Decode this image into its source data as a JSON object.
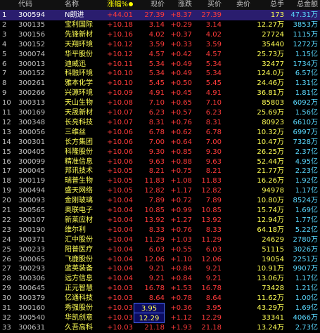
{
  "headers": {
    "idx": "",
    "code": "代码",
    "name": "名称",
    "pct": "涨幅%",
    "price": "现价",
    "chg": "涨跌",
    "bid": "买价",
    "ask": "卖价",
    "vol": "总手",
    "amt": "总金额"
  },
  "rows": [
    {
      "idx": "1",
      "code": "300594",
      "name": "N朗进",
      "pct": "+44.01",
      "price": "27.39",
      "chg": "+8.37",
      "bid": "27.39",
      "ask": "",
      "vol": "173",
      "amt": "47.31万"
    },
    {
      "idx": "2",
      "code": "300135",
      "name": "宝利国际",
      "pct": "+10.18",
      "price": "3.14",
      "chg": "+0.29",
      "bid": "3.14",
      "ask": "",
      "vol": "12.27万",
      "amt": "3853万"
    },
    {
      "idx": "3",
      "code": "300156",
      "name": "先锋新材",
      "pct": "+10.16",
      "price": "4.02",
      "chg": "+0.37",
      "bid": "4.02",
      "ask": "",
      "vol": "27724",
      "amt": "1115万"
    },
    {
      "idx": "4",
      "code": "300152",
      "name": "天翔环境",
      "pct": "+10.12",
      "price": "3.59",
      "chg": "+0.33",
      "bid": "3.59",
      "ask": "",
      "vol": "35440",
      "amt": "1272万"
    },
    {
      "idx": "5",
      "code": "300074",
      "name": "华平股份",
      "pct": "+10.12",
      "price": "4.57",
      "chg": "+0.42",
      "bid": "4.57",
      "ask": "",
      "vol": "25.73万",
      "amt": "1.15亿"
    },
    {
      "idx": "6",
      "code": "300013",
      "name": "迪威迅",
      "pct": "+10.11",
      "price": "5.34",
      "chg": "+0.49",
      "bid": "5.34",
      "ask": "",
      "vol": "32477",
      "amt": "1734万"
    },
    {
      "idx": "7",
      "code": "300152",
      "name": "科融环境",
      "pct": "+10.10",
      "price": "5.34",
      "chg": "+0.49",
      "bid": "5.34",
      "ask": "",
      "vol": "124.0万",
      "amt": "6.57亿"
    },
    {
      "idx": "8",
      "code": "300261",
      "name": "雅本化学",
      "pct": "+10.10",
      "price": "5.45",
      "chg": "+0.50",
      "bid": "5.45",
      "ask": "",
      "vol": "24.46万",
      "amt": "1.31亿"
    },
    {
      "idx": "9",
      "code": "300266",
      "name": "兴源环境",
      "pct": "+10.09",
      "price": "4.91",
      "chg": "+0.45",
      "bid": "4.91",
      "ask": "",
      "vol": "36.81万",
      "amt": "1.81亿"
    },
    {
      "idx": "10",
      "code": "300313",
      "name": "天山生物",
      "pct": "+10.08",
      "price": "7.10",
      "chg": "+0.65",
      "bid": "7.10",
      "ask": "",
      "vol": "85803",
      "amt": "6092万"
    },
    {
      "idx": "11",
      "code": "300169",
      "name": "天晟新材",
      "pct": "+10.07",
      "price": "6.23",
      "chg": "+0.57",
      "bid": "6.23",
      "ask": "",
      "vol": "25.69万",
      "amt": "1.56亿"
    },
    {
      "idx": "12",
      "code": "300348",
      "name": "长亮科技",
      "pct": "+10.07",
      "price": "8.31",
      "chg": "+0.76",
      "bid": "8.31",
      "ask": "",
      "vol": "80923",
      "amt": "6610万"
    },
    {
      "idx": "13",
      "code": "300056",
      "name": "三维丝",
      "pct": "+10.06",
      "price": "6.78",
      "chg": "+0.62",
      "bid": "6.78",
      "ask": "",
      "vol": "10.32万",
      "amt": "6997万"
    },
    {
      "idx": "14",
      "code": "300301",
      "name": "长方集团",
      "pct": "+10.06",
      "price": "7.00",
      "chg": "+0.64",
      "bid": "7.00",
      "ask": "",
      "vol": "10.47万",
      "amt": "7328万"
    },
    {
      "idx": "15",
      "code": "300405",
      "name": "科隆股份",
      "pct": "+10.06",
      "price": "9.30",
      "chg": "+0.85",
      "bid": "9.30",
      "ask": "",
      "vol": "26.25万",
      "amt": "2.37亿"
    },
    {
      "idx": "16",
      "code": "300099",
      "name": "精准信息",
      "pct": "+10.06",
      "price": "9.63",
      "chg": "+0.88",
      "bid": "9.63",
      "ask": "",
      "vol": "52.44万",
      "amt": "4.95亿"
    },
    {
      "idx": "17",
      "code": "300045",
      "name": "邦讯技术",
      "pct": "+10.05",
      "price": "8.21",
      "chg": "+0.75",
      "bid": "8.21",
      "ask": "",
      "vol": "21.77万",
      "amt": "2.23亿"
    },
    {
      "idx": "18",
      "code": "300119",
      "name": "瑞普生物",
      "pct": "+10.05",
      "price": "11.83",
      "chg": "+1.08",
      "bid": "11.83",
      "ask": "",
      "vol": "16.26万",
      "amt": "1.92亿"
    },
    {
      "idx": "19",
      "code": "300494",
      "name": "盛天网络",
      "pct": "+10.05",
      "price": "12.82",
      "chg": "+1.17",
      "bid": "12.82",
      "ask": "",
      "vol": "94978",
      "amt": "1.17亿"
    },
    {
      "idx": "20",
      "code": "300093",
      "name": "金刚玻璃",
      "pct": "+10.04",
      "price": "7.89",
      "chg": "+0.72",
      "bid": "7.89",
      "ask": "",
      "vol": "10.80万",
      "amt": "8524万"
    },
    {
      "idx": "21",
      "code": "300565",
      "name": "奥联电子",
      "pct": "+10.04",
      "price": "10.85",
      "chg": "+0.99",
      "bid": "10.85",
      "ask": "",
      "vol": "15.74万",
      "amt": "1.69亿"
    },
    {
      "idx": "22",
      "code": "300107",
      "name": "新莱应材",
      "pct": "+10.04",
      "price": "13.92",
      "chg": "+1.27",
      "bid": "13.92",
      "ask": "",
      "vol": "12.94万",
      "amt": "1.77亿"
    },
    {
      "idx": "23",
      "code": "300190",
      "name": "维尔利",
      "pct": "+10.04",
      "price": "8.33",
      "chg": "+0.76",
      "bid": "8.33",
      "ask": "",
      "vol": "64.18万",
      "amt": "5.22亿"
    },
    {
      "idx": "24",
      "code": "300371",
      "name": "汇中股份",
      "pct": "+10.04",
      "price": "11.29",
      "chg": "+1.03",
      "bid": "11.29",
      "ask": "",
      "vol": "24629",
      "amt": "2780万"
    },
    {
      "idx": "25",
      "code": "300233",
      "name": "阳普医疗",
      "pct": "+10.04",
      "price": "6.03",
      "chg": "+0.55",
      "bid": "6.03",
      "ask": "",
      "vol": "51115",
      "amt": "3026万"
    },
    {
      "idx": "26",
      "code": "300065",
      "name": "飞鹿股份",
      "pct": "+10.04",
      "price": "12.06",
      "chg": "+1.10",
      "bid": "12.06",
      "ask": "",
      "vol": "19054",
      "amt": "2251万"
    },
    {
      "idx": "27",
      "code": "300293",
      "name": "蓝英装备",
      "pct": "+10.04",
      "price": "9.21",
      "chg": "+0.84",
      "bid": "9.21",
      "ask": "",
      "vol": "10.91万",
      "amt": "9907万"
    },
    {
      "idx": "28",
      "code": "300306",
      "name": "远方信息",
      "pct": "+10.04",
      "price": "9.21",
      "chg": "+0.84",
      "bid": "9.21",
      "ask": "",
      "vol": "13.06万",
      "amt": "1.17亿"
    },
    {
      "idx": "29",
      "code": "300645",
      "name": "正元智慧",
      "pct": "+10.03",
      "price": "16.78",
      "chg": "+1.53",
      "bid": "16.78",
      "ask": "",
      "vol": "73428",
      "amt": "1.21亿"
    },
    {
      "idx": "30",
      "code": "300379",
      "name": "亿通科技",
      "pct": "+10.03",
      "price": "8.64",
      "chg": "+0.78",
      "bid": "8.64",
      "ask": "",
      "vol": "11.62万",
      "amt": "1.00亿"
    },
    {
      "idx": "31",
      "code": "300160",
      "name": "秀强股份",
      "pct": "+10.03",
      "price": "3.95",
      "chg": "+0.36",
      "bid": "3.95",
      "ask": "",
      "vol": "43.29万",
      "amt": "1.69亿"
    },
    {
      "idx": "32",
      "code": "300540",
      "name": "华凯创意",
      "pct": "+10.03",
      "price": "12.29",
      "chg": "+1.12",
      "bid": "12.29",
      "ask": "",
      "vol": "33341",
      "amt": "4066万"
    },
    {
      "idx": "33",
      "code": "300631",
      "name": "久吾高科",
      "pct": "+10.03",
      "price": "21.18",
      "chg": "+1.93",
      "bid": "21.18",
      "ask": "",
      "vol": "13.24万",
      "amt": "2.73亿"
    }
  ],
  "colors": {
    "rise": "#ff3b3b",
    "name": "#ffff55",
    "amount": "#5ad9ff",
    "selected_row_bg": "#2a1d6e"
  },
  "selected_row": "1",
  "highlighted_cells": [
    {
      "row": "31",
      "col": "price"
    },
    {
      "row": "32",
      "col": "price"
    }
  ]
}
